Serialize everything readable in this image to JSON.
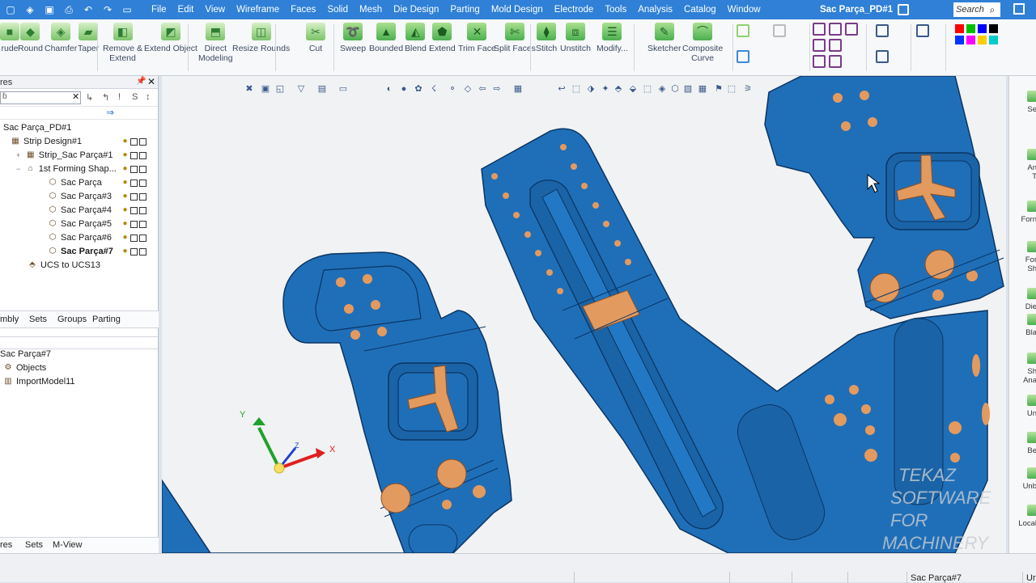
{
  "colors": {
    "accent": "#2f80d6",
    "part_blue": "#1f6fb8",
    "part_edge": "#0b3564",
    "hole_orange": "#e39a5f",
    "background": "#f1f2f3"
  },
  "menubar": {
    "quick_access": [
      "new-icon",
      "open-icon",
      "save-icon",
      "print-icon",
      "undo-icon",
      "redo-icon",
      "window-icon"
    ],
    "menus": [
      "File",
      "Edit",
      "View",
      "Wireframe",
      "Faces",
      "Solid",
      "Mesh",
      "Die Design",
      "Parting",
      "Mold Design",
      "Electrode",
      "Tools",
      "Analysis",
      "Catalog",
      "Window"
    ],
    "doc_title": "Sac Parça_PD#1",
    "search_placeholder": "Search"
  },
  "ribbon": {
    "buttons": [
      {
        "label": "rude",
        "icon": "extrude-icon"
      },
      {
        "label": "Round",
        "icon": "round-icon"
      },
      {
        "label": "Chamfer",
        "icon": "chamfer-icon"
      },
      {
        "label": "Taper",
        "icon": "taper-icon"
      },
      {
        "label": "Remove &\nExtend",
        "icon": "remove-extend-icon"
      },
      {
        "label": "Extend Object",
        "icon": "extend-object-icon"
      },
      {
        "label": "Direct\nModeling",
        "icon": "direct-modeling-icon"
      },
      {
        "label": "Resize Rounds",
        "icon": "resize-rounds-icon"
      },
      {
        "label": "Cut",
        "icon": "cut-icon"
      },
      {
        "label": "Sweep",
        "icon": "sweep-icon"
      },
      {
        "label": "Bounded",
        "icon": "bounded-icon"
      },
      {
        "label": "Blend",
        "icon": "blend-icon"
      },
      {
        "label": "Extend",
        "icon": "extend-icon"
      },
      {
        "label": "Trim Face",
        "icon": "trim-face-icon"
      },
      {
        "label": "Split Faces",
        "icon": "split-faces-icon"
      },
      {
        "label": "Stitch",
        "icon": "stitch-icon"
      },
      {
        "label": "Unstitch",
        "icon": "unstitch-icon"
      },
      {
        "label": "Modify...",
        "icon": "modify-icon"
      },
      {
        "label": "Sketcher",
        "icon": "sketcher-icon"
      },
      {
        "label": "Composite\nCurve",
        "icon": "composite-curve-icon"
      }
    ]
  },
  "left_panel": {
    "header": "res",
    "tree": [
      {
        "label": "Sac Parça_PD#1",
        "level": 0,
        "bold": false
      },
      {
        "label": "Strip Design#1",
        "level": 1,
        "bold": false
      },
      {
        "label": "Strip_Sac Parça#1",
        "level": 2,
        "bold": false
      },
      {
        "label": "1st Forming Shap...",
        "level": 2,
        "bold": false
      },
      {
        "label": "Sac Parça",
        "level": 3,
        "bold": false
      },
      {
        "label": "Sac Parça#3",
        "level": 3,
        "bold": false
      },
      {
        "label": "Sac Parça#4",
        "level": 3,
        "bold": false
      },
      {
        "label": "Sac Parça#5",
        "level": 3,
        "bold": false
      },
      {
        "label": "Sac Parça#6",
        "level": 3,
        "bold": false
      },
      {
        "label": "Sac Parça#7",
        "level": 3,
        "bold": true
      },
      {
        "label": "UCS to UCS13",
        "level": 2,
        "bold": false
      }
    ],
    "tabs_top": [
      "mbly",
      "Sets",
      "Groups",
      "Parting"
    ],
    "lower_tree": [
      {
        "label": "Sac Parça#7"
      },
      {
        "label": "Objects"
      },
      {
        "label": "ImportModel11"
      }
    ],
    "tabs_bottom": [
      "res",
      "Sets",
      "M-View"
    ]
  },
  "viewport": {
    "axis_labels": {
      "x": "X",
      "y": "Y",
      "z": "Z"
    },
    "watermark_lines": [
      "TEKAZ",
      "SOFTWARE FOR",
      "MACHINERY"
    ]
  },
  "right_panel": {
    "items": [
      "Se",
      "An\nT",
      "Forn",
      "For\nSh",
      "Die",
      "Bla",
      "Sh\nAna",
      "Un",
      "Be",
      "Unb",
      "Local"
    ]
  },
  "status_bar": {
    "active_part": "Sac Parça#7",
    "tail": "Ur"
  }
}
